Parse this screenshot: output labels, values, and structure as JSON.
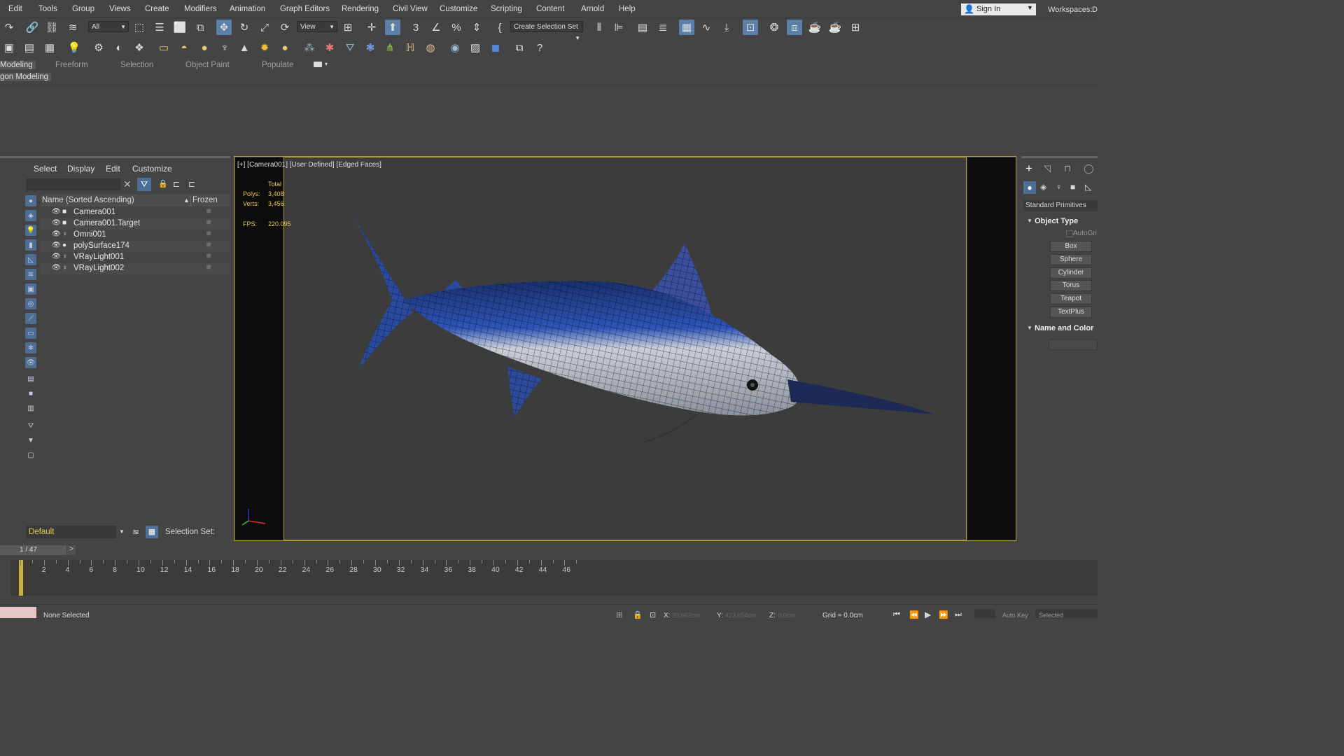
{
  "menu": [
    "Edit",
    "Tools",
    "Group",
    "Views",
    "Create",
    "Modifiers",
    "Animation",
    "Graph Editors",
    "Rendering",
    "Civil View",
    "Customize",
    "Scripting",
    "Content",
    "Arnold",
    "Help"
  ],
  "sign_in": "Sign In",
  "workspaces_label": "Workspaces:",
  "workspaces_value": "D",
  "toolbar": {
    "filter_value": "All",
    "reference_coord": "View",
    "selection_set": "Create Selection Set"
  },
  "ribbon_tabs": [
    "Modeling",
    "Freeform",
    "Selection",
    "Object Paint",
    "Populate"
  ],
  "ribbon_sub": "gon Modeling",
  "scene_explorer": {
    "menu": [
      "Select",
      "Display",
      "Edit",
      "Customize"
    ],
    "col_name": "Name (Sorted Ascending)",
    "sort_arrow": "▲",
    "col_frozen": "Frozen",
    "items": [
      "Camera001",
      "Camera001.Target",
      "Omni001",
      "polySurface174",
      "VRayLight001",
      "VRayLight002"
    ],
    "layer": "Default",
    "selection_set_label": "Selection Set:"
  },
  "viewport": {
    "label": "[+] [Camera001] [User Defined] [Edged Faces]",
    "stats_total": "Total",
    "polys_label": "Polys:",
    "polys_value": "3,408",
    "verts_label": "Verts:",
    "verts_value": "3,456",
    "fps_label": "FPS:",
    "fps_value": "220.095"
  },
  "command_panel": {
    "category": "Standard Primitives",
    "object_type_title": "Object Type",
    "autogrid": "AutoGri",
    "buttons": [
      "Box",
      "Sphere",
      "Cylinder",
      "Torus",
      "Teapot",
      "TextPlus"
    ],
    "name_color_title": "Name and Color"
  },
  "timeline": {
    "frame": "1 / 47",
    "next": ">",
    "ticks": [
      "2",
      "4",
      "6",
      "8",
      "10",
      "12",
      "14",
      "16",
      "18",
      "20",
      "22",
      "24",
      "26",
      "28",
      "30",
      "32",
      "34",
      "36",
      "38",
      "40",
      "42",
      "44",
      "46"
    ]
  },
  "status": {
    "selection": "None Selected",
    "x_label": "X:",
    "x_value": "20.662cm",
    "y_label": "Y:",
    "y_value": "423.054cm",
    "z_label": "Z:",
    "z_value": "0.0cm",
    "grid": "Grid = 0.0cm",
    "auto_key": "Auto Key",
    "selected": "Selected"
  },
  "colors": {
    "accent": "#5b7fa8",
    "viewport_frame": "#b49b30",
    "stats_text": "#e8c84a",
    "layer_text": "#e8c84a"
  }
}
